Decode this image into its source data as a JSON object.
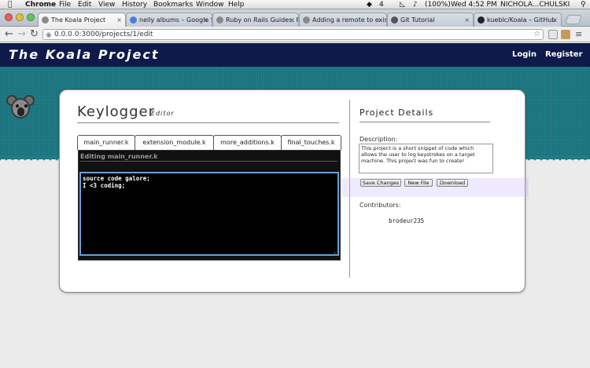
{
  "mac_menu": {
    "app": "Chrome",
    "items": [
      "File",
      "Edit",
      "View",
      "History",
      "Bookmarks",
      "Window",
      "Help"
    ],
    "status_battery": "(100%)",
    "status_badge": "4",
    "clock": "Wed 4:52 PM",
    "user": "NICHOLA...CHULSKI"
  },
  "browser": {
    "tabs": [
      {
        "label": "The Koala Project",
        "active": true
      },
      {
        "label": "nelly albums – Google Sea",
        "active": false
      },
      {
        "label": "Ruby on Rails Guides: Rail",
        "active": false
      },
      {
        "label": "Adding a remote to existi",
        "active": false
      },
      {
        "label": "Git Tutorial",
        "active": false
      },
      {
        "label": "kueblc/Koala – GitHub",
        "active": false
      }
    ],
    "url": "0.0.0.0:3000/projects/1/edit"
  },
  "site": {
    "logo": "The Koala Project",
    "nav": {
      "login": "Login",
      "register": "Register"
    }
  },
  "editor": {
    "title": "Keylogger",
    "subtitle": "Editor",
    "file_tabs": [
      "main_runner.k",
      "extension_module.k",
      "more_additions.k",
      "final_touches.k"
    ],
    "editing_label": "Editing main_runner.k",
    "code": "source code galore;\nI <3 coding;"
  },
  "details": {
    "title": "Project Details",
    "description_label": "Description:",
    "description": "This project is a short snippet of code which allows the user to log keystrokes on a target machine. This project was fun to create!",
    "buttons": {
      "save": "Save Changes",
      "new_file": "New File",
      "download": "Download"
    },
    "contributors_label": "Contributors:",
    "contributors": [
      "brodeur235"
    ]
  },
  "colors": {
    "header_bg": "#0e1a4a",
    "banner": "#1f7c86",
    "code_border": "#6a9fd4"
  }
}
